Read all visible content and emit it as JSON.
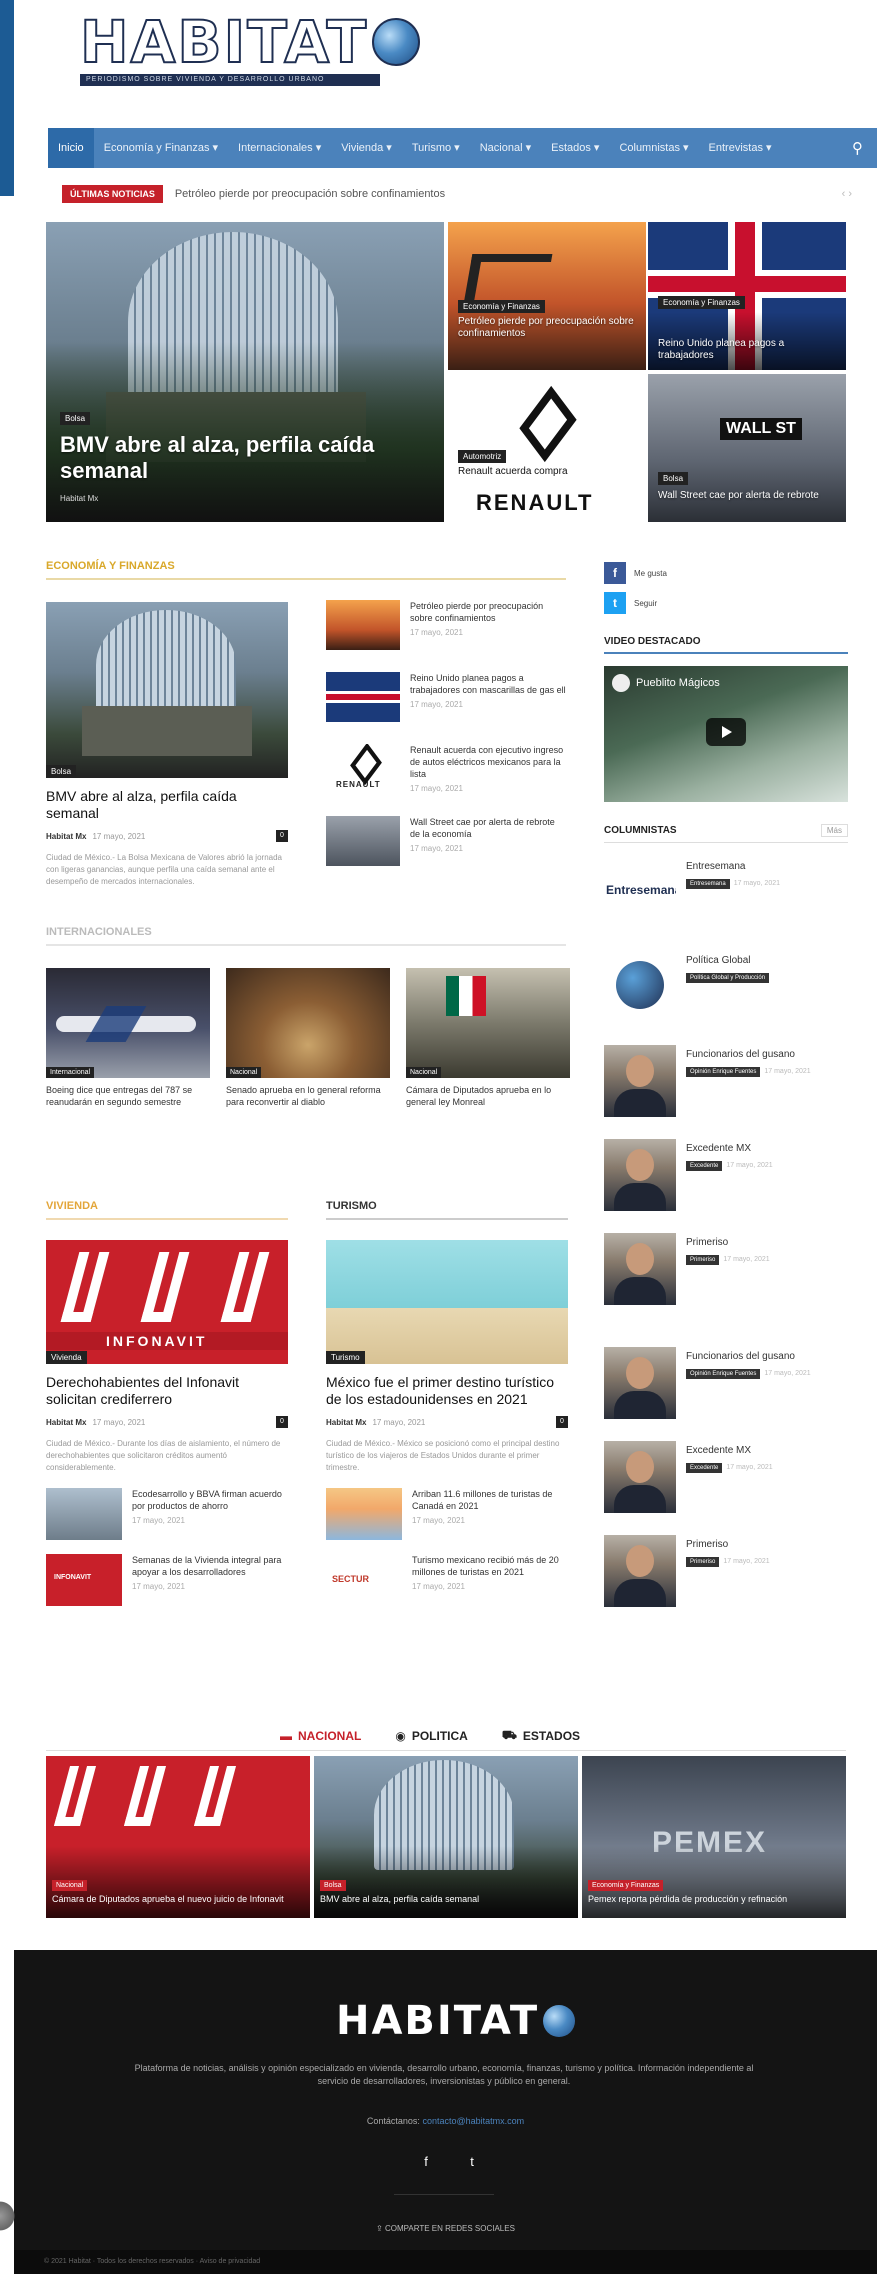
{
  "site": {
    "logo_text": "HABITAT",
    "logo_sub": "PERIODISMO SOBRE VIVIENDA Y DESARROLLO URBANO"
  },
  "nav": {
    "items": [
      {
        "label": "Inicio"
      },
      {
        "label": "Economía y Finanzas ▾"
      },
      {
        "label": "Internacionales ▾"
      },
      {
        "label": "Vivienda ▾"
      },
      {
        "label": "Turismo ▾"
      },
      {
        "label": "Nacional ▾"
      },
      {
        "label": "Estados ▾"
      },
      {
        "label": "Columnistas ▾"
      },
      {
        "label": "Entrevistas ▾"
      }
    ]
  },
  "breaking": {
    "label": "ÚLTIMAS NOTICIAS",
    "text": "Petróleo pierde por preocupación sobre confinamientos",
    "arrows": "‹  ›"
  },
  "hero": {
    "big": {
      "category": "Bolsa",
      "title": "BMV abre al alza, perfila caída semanal",
      "meta": "Habitat Mx"
    },
    "oil": {
      "category": "Economía y Finanzas",
      "title": "Petróleo pierde por preocupación sobre confinamientos"
    },
    "uk": {
      "category": "Economía y Finanzas",
      "title": "Reino Unido planea pagos a trabajadores"
    },
    "renault": {
      "category": "Automotriz",
      "title": "Renault acuerda compra",
      "logo_word": "RENAULT"
    },
    "wall": {
      "category": "Bolsa",
      "title": "Wall Street cae por alerta de rebrote",
      "sign": "WALL ST"
    }
  },
  "economia": {
    "heading": "ECONOMÍA Y FINANZAS",
    "feature": {
      "category": "Bolsa",
      "title": "BMV abre al alza, perfila caída semanal",
      "author": "Habitat Mx",
      "date": "17 mayo, 2021",
      "comments": "0",
      "excerpt": "Ciudad de México.- La Bolsa Mexicana de Valores abrió la jornada con ligeras ganancias, aunque perfila una caída semanal ante el desempeño de mercados internacionales."
    },
    "side": [
      {
        "title": "Petróleo pierde por preocupación sobre confinamientos",
        "date": "17 mayo, 2021"
      },
      {
        "title": "Reino Unido planea pagos a trabajadores con mascarillas de gas ell",
        "date": "17 mayo, 2021"
      },
      {
        "title": "Renault acuerda con ejecutivo ingreso de autos eléctricos mexicanos para la lista",
        "date": "17 mayo, 2021",
        "logo_word": "RENAULT"
      },
      {
        "title": "Wall Street cae por alerta de rebrote de la economía",
        "date": "17 mayo, 2021"
      }
    ]
  },
  "internacionales": {
    "heading": "INTERNACIONALES",
    "cards": [
      {
        "category": "Internacional",
        "title": "Boeing dice que entregas del 787 se reanudarán en segundo semestre"
      },
      {
        "category": "Nacional",
        "title": "Senado aprueba en lo general reforma para reconvertir al diablo"
      },
      {
        "category": "Nacional",
        "title": "Cámara de Diputados aprueba en lo general ley Monreal"
      }
    ]
  },
  "vivienda": {
    "heading": "VIVIENDA",
    "feature": {
      "category": "Vivienda",
      "brand": "INFONAVIT",
      "title": "Derechohabientes del Infonavit solicitan crediferrero",
      "author": "Habitat Mx",
      "date": "17 mayo, 2021",
      "comments": "0",
      "excerpt": "Ciudad de México.- Durante los días de aislamiento, el número de derechohabientes que solicitaron créditos aumentó considerablemente."
    },
    "mini": [
      {
        "title": "Ecodesarrollo y BBVA firman acuerdo por productos de ahorro",
        "date": "17 mayo, 2021"
      },
      {
        "title": "Semanas de la Vivienda integral para apoyar a los desarrolladores",
        "date": "17 mayo, 2021",
        "logo_word": "INFONAVIT"
      }
    ]
  },
  "turismo": {
    "heading": "TURISMO",
    "feature": {
      "category": "Turismo",
      "title": "México fue el primer destino turístico de los estadounidenses en 2021",
      "author": "Habitat Mx",
      "date": "17 mayo, 2021",
      "comments": "0",
      "excerpt": "Ciudad de México.- México se posicionó como el principal destino turístico de los viajeros de Estados Unidos durante el primer trimestre."
    },
    "mini": [
      {
        "title": "Arriban 11.6 millones de turistas de Canadá en 2021",
        "date": "17 mayo, 2021"
      },
      {
        "title": "Turismo mexicano recibió más de 20 millones de turistas en 2021",
        "date": "17 mayo, 2021",
        "logo_word": "SECTUR"
      }
    ]
  },
  "sidebar": {
    "facebook": {
      "icon": "f",
      "label": "Me gusta"
    },
    "twitter": {
      "icon": "t",
      "label": "Seguir"
    },
    "video_heading": "VIDEO DESTACADO",
    "video_title": "Pueblito Mágicos",
    "columnists_heading": "COLUMNISTAS",
    "more": "Más",
    "columnists": [
      {
        "name": "Entresemana",
        "tag": "Entresemana",
        "date": "17 mayo, 2021",
        "pic": "logo",
        "logo_word": "Entresemana"
      },
      {
        "name": "Política Global",
        "tag": "Política Global y Producción",
        "date": "",
        "pic": "globe"
      },
      {
        "name": "Funcionarios del gusano",
        "tag": "Opinión Enrique Fuentes",
        "date": "17 mayo, 2021",
        "pic": "man"
      },
      {
        "name": "Excedente MX",
        "tag": "Excedente",
        "date": "17 mayo, 2021",
        "pic": "man"
      },
      {
        "name": "Primeriso",
        "tag": "Primeriso",
        "date": "17 mayo, 2021",
        "pic": "man"
      },
      {
        "name": "Funcionarios del gusano",
        "tag": "Opinión Enrique Fuentes",
        "date": "17 mayo, 2021",
        "pic": "man"
      },
      {
        "name": "Excedente MX",
        "tag": "Excedente",
        "date": "17 mayo, 2021",
        "pic": "man"
      },
      {
        "name": "Primeriso",
        "tag": "Primeriso",
        "date": "17 mayo, 2021",
        "pic": "man"
      }
    ]
  },
  "category_tabs": {
    "items": [
      {
        "label": "NACIONAL",
        "icon": "▬"
      },
      {
        "label": "POLITICA",
        "icon": "◉"
      },
      {
        "label": "ESTADOS",
        "icon": "⛟"
      }
    ]
  },
  "strip": [
    {
      "category": "Nacional",
      "title": "Cámara de Diputados aprueba el nuevo juicio de Infonavit",
      "brand": "INFONAVIT"
    },
    {
      "category": "Bolsa",
      "title": "BMV abre al alza, perfila caída semanal"
    },
    {
      "category": "Economía y Finanzas",
      "title": "Pemex reporta pérdida de producción y refinación",
      "brand": "PEMEX"
    }
  ],
  "footer": {
    "logo_text": "HABITAT",
    "description": "Plataforma de noticias, análisis y opinión especializado en vivienda, desarrollo urbano, economía, finanzas, turismo y política. Información independiente al servicio de desarrolladores, inversionistas y público en general.",
    "contact_label": "Contáctanos:",
    "contact_email": "contacto@habitatmx.com",
    "social": [
      {
        "icon": "f"
      },
      {
        "icon": "t"
      }
    ],
    "share": "⇪  COMPARTE EN REDES SOCIALES",
    "bottom": "© 2021 Habitat · Todos los derechos reservados · Aviso de privacidad"
  },
  "colors": {
    "brand_blue": "#4b82bb",
    "brand_navy": "#1f2f52",
    "accent_red": "#c5212a",
    "footer_bg": "#141414"
  }
}
